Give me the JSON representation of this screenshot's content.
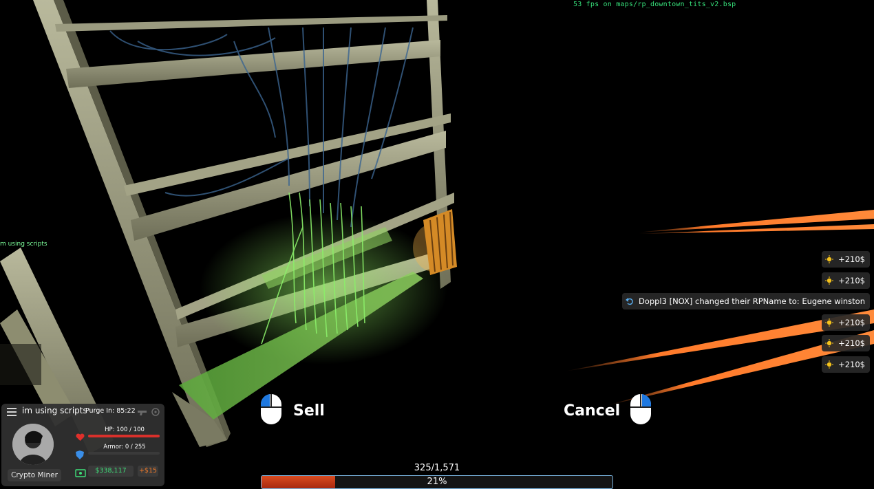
{
  "fps_text": "53 fps on maps/rp_downtown_tits_v2.bsp",
  "chat_line": "m using scripts",
  "notifications": [
    {
      "icon": "lightbulb-icon",
      "text": "+210$"
    },
    {
      "icon": "lightbulb-icon",
      "text": "+210$"
    },
    {
      "icon": "undo-icon",
      "text": "Doppl3  [NOX] changed their RPName to: Eugene winston"
    },
    {
      "icon": "lightbulb-icon",
      "text": "+210$"
    },
    {
      "icon": "lightbulb-icon",
      "text": "+210$"
    },
    {
      "icon": "lightbulb-icon",
      "text": "+210$"
    }
  ],
  "actions": {
    "sell_label": "Sell",
    "cancel_label": "Cancel"
  },
  "progress": {
    "count_text": "325/1,571",
    "percent_text": "21%",
    "fraction": 0.21
  },
  "hud": {
    "player_name": "im using scripts",
    "purge_text": "Purge  In: 85:22",
    "job": "Crypto Miner",
    "hp_text": "HP: 100 / 100",
    "hp_fraction": 1.0,
    "armor_text": "Armor: 0 / 255",
    "armor_fraction": 0.0,
    "money": "$338,117",
    "salary": "+$15"
  },
  "colors": {
    "accent_green": "#36e07a",
    "hp_red": "#d9302b",
    "armor_blue": "#7ec3f2",
    "progress_orange": "#d94b1f",
    "notif_lightbulb": "#f5c21b"
  }
}
